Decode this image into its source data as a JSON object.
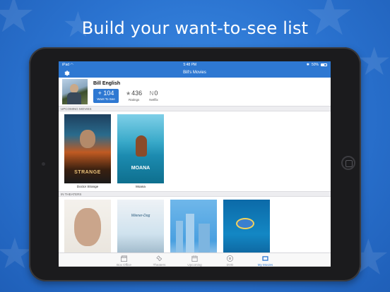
{
  "headline": "Build your want-to-see list",
  "status_bar": {
    "carrier": "iPad",
    "wifi": "◠",
    "time": "5:48 PM",
    "battery": "50%"
  },
  "nav_bar": {
    "title": "Bill's Movies"
  },
  "profile": {
    "name": "Bill English",
    "want_to_see": {
      "count": "104",
      "label": "Want To See"
    },
    "ratings": {
      "count": "436",
      "label": "Ratings"
    },
    "netflix": {
      "count": "0",
      "label": "Netflix"
    }
  },
  "sections": {
    "upcoming": {
      "header": "UPCOMING MOVIES",
      "movies": [
        {
          "title": "Doctor Strange",
          "poster_text": "STRANGE"
        },
        {
          "title": "Moana",
          "poster_text": "MOANA"
        }
      ]
    },
    "in_theaters": {
      "header": "IN THEATERS",
      "movies": [
        {
          "title": ""
        },
        {
          "title": "",
          "poster_text": "Wiener-Dog"
        },
        {
          "title": ""
        },
        {
          "title": ""
        }
      ]
    }
  },
  "tab_bar": {
    "tabs": [
      {
        "label": "Box Office",
        "icon": "clapperboard-icon"
      },
      {
        "label": "Theaters",
        "icon": "ticket-icon"
      },
      {
        "label": "Upcoming",
        "icon": "calendar-icon"
      },
      {
        "label": "DVD",
        "icon": "disc-icon"
      },
      {
        "label": "My Movies",
        "icon": "film-icon",
        "active": true
      }
    ]
  },
  "colors": {
    "accent": "#2e78d2",
    "background": "#2a72cf",
    "section_header_bg": "#ededf0",
    "inactive_tab": "#8e8e93"
  }
}
